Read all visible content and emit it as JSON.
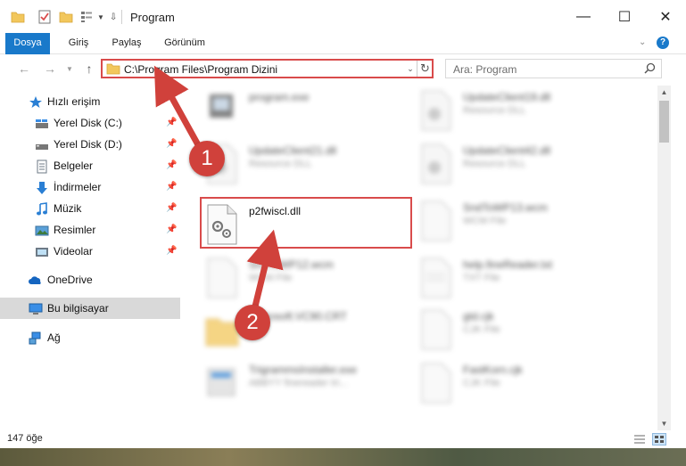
{
  "window": {
    "title": "Program",
    "controls": {
      "minimize": "—",
      "maximize": "☐",
      "close": "✕"
    }
  },
  "ribbon": {
    "tabs": [
      {
        "label": "Dosya",
        "active": true
      },
      {
        "label": "Giriş"
      },
      {
        "label": "Paylaş"
      },
      {
        "label": "Görünüm"
      }
    ]
  },
  "nav": {
    "address": "C:\\Program Files\\Program Dizini",
    "search_placeholder": "Ara: Program"
  },
  "sidebar": {
    "items": [
      {
        "label": "Hızlı erişim",
        "icon": "star-icon"
      },
      {
        "label": "Yerel Disk (C:)",
        "icon": "drive-icon",
        "pinned": true
      },
      {
        "label": "Yerel Disk (D:)",
        "icon": "drive-icon",
        "pinned": true
      },
      {
        "label": "Belgeler",
        "icon": "documents-icon",
        "pinned": true
      },
      {
        "label": "İndirmeler",
        "icon": "download-icon",
        "pinned": true
      },
      {
        "label": "Müzik",
        "icon": "music-icon",
        "pinned": true
      },
      {
        "label": "Resimler",
        "icon": "pictures-icon",
        "pinned": true
      },
      {
        "label": "Videolar",
        "icon": "videos-icon",
        "pinned": true
      },
      {
        "label": "OneDrive",
        "icon": "cloud-icon"
      },
      {
        "label": "Bu bilgisayar",
        "icon": "computer-icon",
        "selected": true
      },
      {
        "label": "Ağ",
        "icon": "network-icon"
      }
    ]
  },
  "files": [
    {
      "name": "program.exe",
      "type": "",
      "blurred": true
    },
    {
      "name": "UpdateClient19.dll",
      "type": "Resource DLL",
      "blurred": true
    },
    {
      "name": "UpdateClient21.dll",
      "type": "Resource DLL",
      "blurred": true
    },
    {
      "name": "UpdateClient42.dll",
      "type": "Resource DLL",
      "blurred": true
    },
    {
      "name": "p2fwiscl.dll",
      "type": "",
      "blurred": false
    },
    {
      "name": "SndToWP13.wcm",
      "type": "WCM File",
      "blurred": true
    },
    {
      "name": "SndToWP12.wcm",
      "type": "WCM File",
      "blurred": true
    },
    {
      "name": "help.fineReader.txt",
      "type": "TXT File",
      "blurred": true
    },
    {
      "name": "Microsoft.VC90.CRT",
      "type": "",
      "blurred": true
    },
    {
      "name": "gtd.cjk",
      "type": "CJK File",
      "blurred": true
    },
    {
      "name": "TrigrammsInstaller.exe",
      "type": "ABBYY finereader tri...",
      "blurred": true
    },
    {
      "name": "FastKorn.cjk",
      "type": "CJK File",
      "blurred": true
    }
  ],
  "status": {
    "item_count": "147 öğe"
  },
  "markers": {
    "step1": "1",
    "step2": "2"
  },
  "colors": {
    "accent": "#1979ca",
    "highlight": "#d94b4b",
    "marker": "#d0413b"
  }
}
